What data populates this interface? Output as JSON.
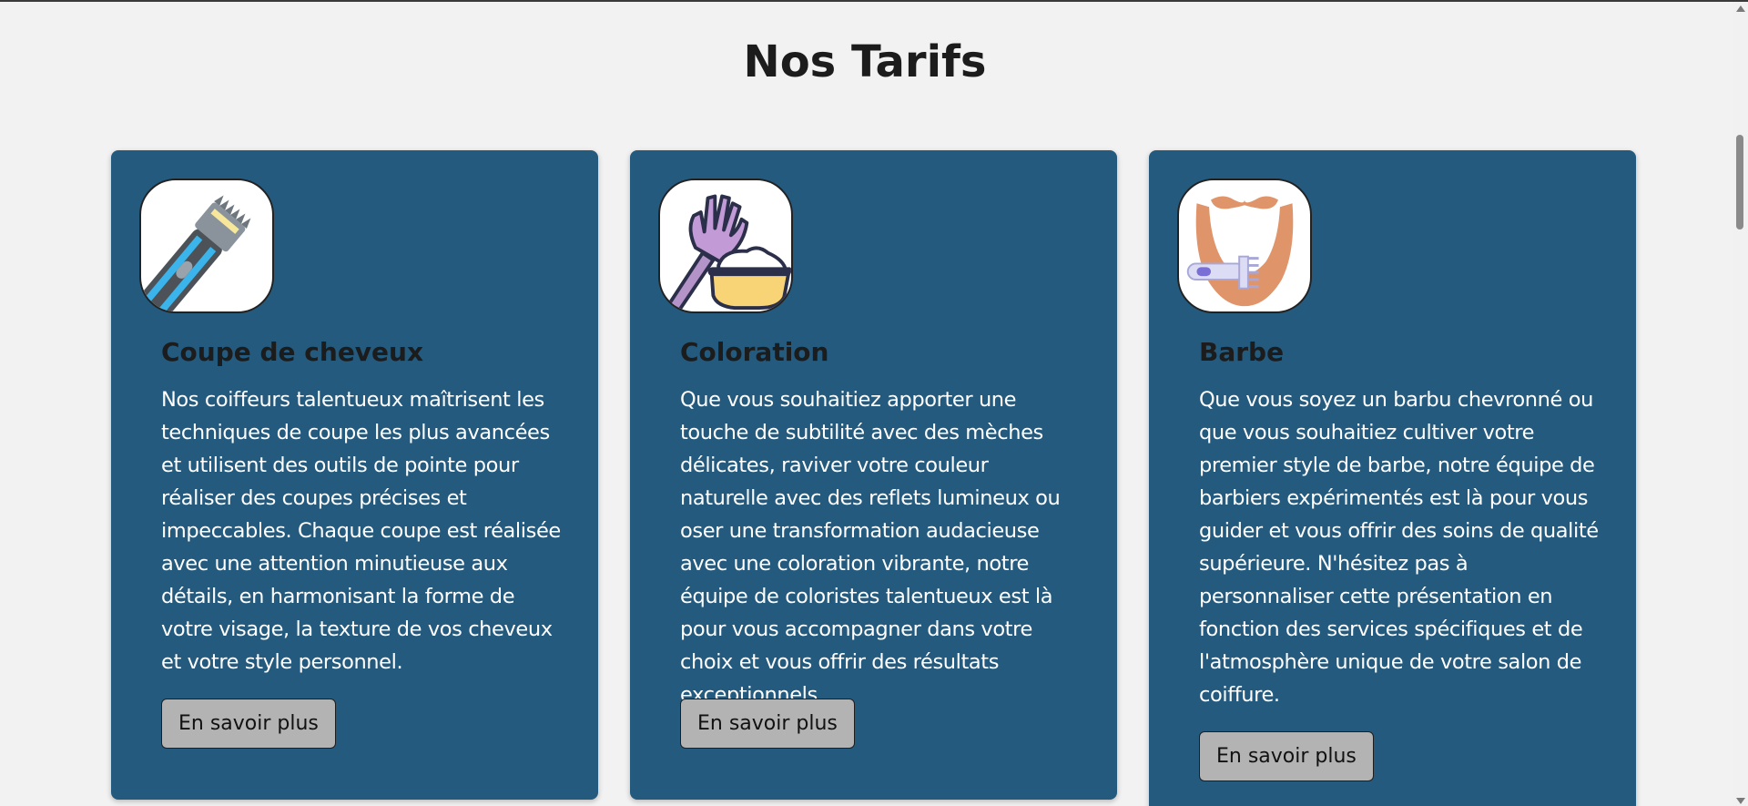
{
  "page": {
    "title": "Nos Tarifs"
  },
  "cards": [
    {
      "icon": "hair-clipper-icon",
      "title": "Coupe de cheveux",
      "description": "Nos coiffeurs talentueux maîtrisent les techniques de coupe les plus avancées et utilisent des outils de pointe pour réaliser des coupes précises et impeccables. Chaque coupe est réalisée avec une attention minutieuse aux détails, en harmonisant la forme de votre visage, la texture de vos cheveux et votre style personnel.",
      "button_label": "En savoir plus"
    },
    {
      "icon": "hair-dye-brush-icon",
      "title": "Coloration",
      "description": "Que vous souhaitiez apporter une touche de subtilité avec des mèches délicates, raviver votre couleur naturelle avec des reflets lumineux ou oser une transformation audacieuse avec une coloration vibrante, notre équipe de coloristes talentueux est là pour vous accompagner dans votre choix et vous offrir des résultats exceptionnels.",
      "button_label": "En savoir plus"
    },
    {
      "icon": "beard-trimmer-icon",
      "title": "Barbe",
      "description": "Que vous soyez un barbu chevronné ou que vous souhaitiez cultiver votre premier style de barbe, notre équipe de barbiers expérimentés est là pour vous guider et vous offrir des soins de qualité supérieure. N'hésitez pas à personnaliser cette présentation en fonction des services spécifiques et de l'atmosphère unique de votre salon de coiffure.",
      "button_label": "En savoir plus"
    }
  ],
  "colors": {
    "background": "#f2f2f2",
    "card": "#235a7e",
    "button": "#b3b3b3",
    "title_text": "#1c1c1c",
    "body_text": "#ffffff"
  }
}
